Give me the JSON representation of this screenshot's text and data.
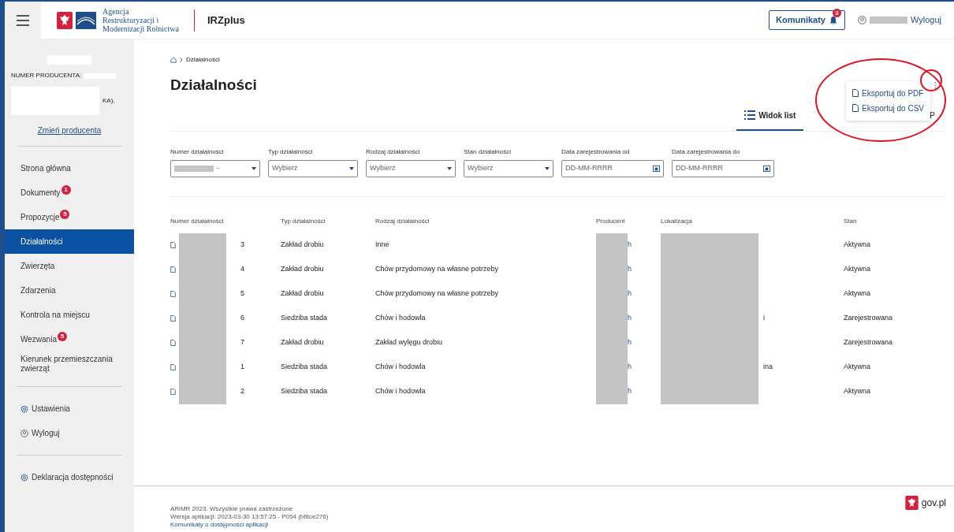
{
  "header": {
    "agency": "Agencja Restrukturyzacji i Modernizacji Rolnictwa",
    "app": "IRZplus",
    "messages": {
      "label": "Komunikaty",
      "count": "3"
    },
    "logout": "Wyloguj"
  },
  "producer": {
    "number_label": "NUMER PRODUCENTA:",
    "address_fragment": "KA),",
    "change_link": "Zmień producenta"
  },
  "sidebar": {
    "items": [
      {
        "label": "Strona główna",
        "selected": false
      },
      {
        "label": "Dokumenty",
        "badge": "1",
        "selected": false
      },
      {
        "label": "Propozycje",
        "badge": "5",
        "selected": false
      },
      {
        "label": "Działalności",
        "selected": true
      },
      {
        "label": "Zwierzęta",
        "selected": false
      },
      {
        "label": "Zdarzenia",
        "selected": false
      },
      {
        "label": "Kontrola na miejscu",
        "selected": false
      },
      {
        "label": "Wezwania",
        "badge": "5",
        "selected": false
      },
      {
        "label": "Kierunek przemieszczania zwierząt",
        "selected": false
      }
    ],
    "settings": [
      {
        "label": "Ustawienia",
        "kind": "gear"
      },
      {
        "label": "Wyloguj",
        "kind": "user"
      }
    ],
    "footer_link": "Deklaracja dostępności"
  },
  "breadcrumb": "Działalności",
  "title": "Działalności",
  "view_tabs": [
    {
      "label": "Widok list",
      "selected": true
    },
    {
      "label": "P",
      "selected": false
    }
  ],
  "export_menu": [
    "Eksportuj do PDF",
    "Eksportuj do CSV"
  ],
  "filters": [
    {
      "label": "Numer działalności",
      "kind": "select",
      "value": "-"
    },
    {
      "label": "Typ działalności",
      "kind": "select",
      "placeholder": "Wybierz"
    },
    {
      "label": "Rodzaj działalności",
      "kind": "select",
      "placeholder": "Wybierz"
    },
    {
      "label": "Stan działalności",
      "kind": "select",
      "placeholder": "Wybierz"
    },
    {
      "label": "Data zarejestrowania od",
      "kind": "date",
      "placeholder": "DD-MM-RRRR"
    },
    {
      "label": "Data zarejestrowania do",
      "kind": "date",
      "placeholder": "DD-MM-RRRR"
    }
  ],
  "table": {
    "columns": [
      "Numer działalności",
      "Typ działalności",
      "Rodzaj działalności",
      "Producent",
      "Lokalizacja",
      "Stan"
    ],
    "rows": [
      {
        "number": "3",
        "type": "Zakład drobiu",
        "kind": "Inne",
        "producer": "h",
        "location": "",
        "status": "Aktywna"
      },
      {
        "number": "4",
        "type": "Zakład drobiu",
        "kind": "Chów przydomowy na własne potrzeby",
        "producer": "h",
        "location": "",
        "status": "Aktywna"
      },
      {
        "number": "5",
        "type": "Zakład drobiu",
        "kind": "Chów przydomowy na własne potrzeby",
        "producer": "h",
        "location": "",
        "status": "Aktywna"
      },
      {
        "number": "6",
        "type": "Siedziba stada",
        "kind": "Chów i hodowla",
        "producer": "h",
        "location": "i",
        "status": "Zarejestrowana"
      },
      {
        "number": "7",
        "type": "Zakład drobiu",
        "kind": "Zakład wylęgu drobiu",
        "producer": "h",
        "location": "",
        "status": "Zarejestrowana"
      },
      {
        "number": "1",
        "type": "Siedziba stada",
        "kind": "Chów i hodowla",
        "producer": "h",
        "location": "ina",
        "status": "Aktywna"
      },
      {
        "number": "2",
        "type": "Siedziba stada",
        "kind": "Chów i hodowla",
        "producer": "h",
        "location": "",
        "status": "Aktywna"
      }
    ]
  },
  "footer": {
    "lines": [
      "ARiMR 2023. Wszystkie prawa zastrzeżone",
      "Wersja aplikacji: 2023-03-30 13:57:25 - P054 (bf8ce276)"
    ],
    "link": "Komunikaty o dostępności aplikacji",
    "gov": "gov.pl"
  }
}
